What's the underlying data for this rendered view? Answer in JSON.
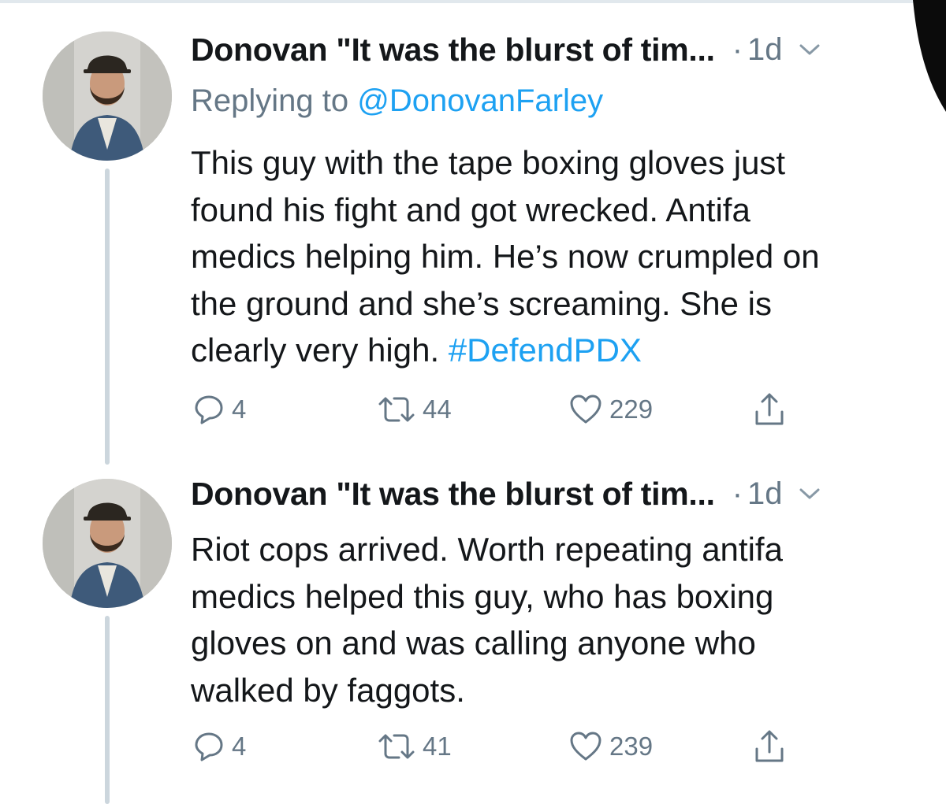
{
  "tweets": [
    {
      "display_name": "Donovan \"It was the blurst of tim...",
      "separator": "·",
      "timestamp": "1d",
      "replying_label": "Replying to",
      "replying_handle": "@DonovanFarley",
      "text_lines": [
        "This guy with the tape boxing gloves just",
        "found his fight and got wrecked. Antifa",
        "medics helping him. He’s now crumpled on",
        "the ground and she’s screaming. She is",
        "clearly very high."
      ],
      "hashtag": "#DefendPDX",
      "replies": "4",
      "retweets": "44",
      "likes": "229"
    },
    {
      "display_name": "Donovan \"It was the blurst of tim...",
      "separator": "·",
      "timestamp": "1d",
      "text_lines": [
        "Riot cops arrived. Worth repeating antifa",
        "medics helped this guy, who has boxing",
        "gloves on and was calling anyone who",
        "walked by faggots."
      ],
      "replies": "4",
      "retweets": "41",
      "likes": "239"
    }
  ],
  "icons": {
    "reply": "reply-icon",
    "retweet": "retweet-icon",
    "like": "heart-icon",
    "share": "share-icon",
    "menu": "chevron-down-icon"
  },
  "colors": {
    "link": "#1da1f2",
    "secondary_text": "#657786",
    "primary_text": "#14171a",
    "thread_line": "#ccd6dd"
  }
}
